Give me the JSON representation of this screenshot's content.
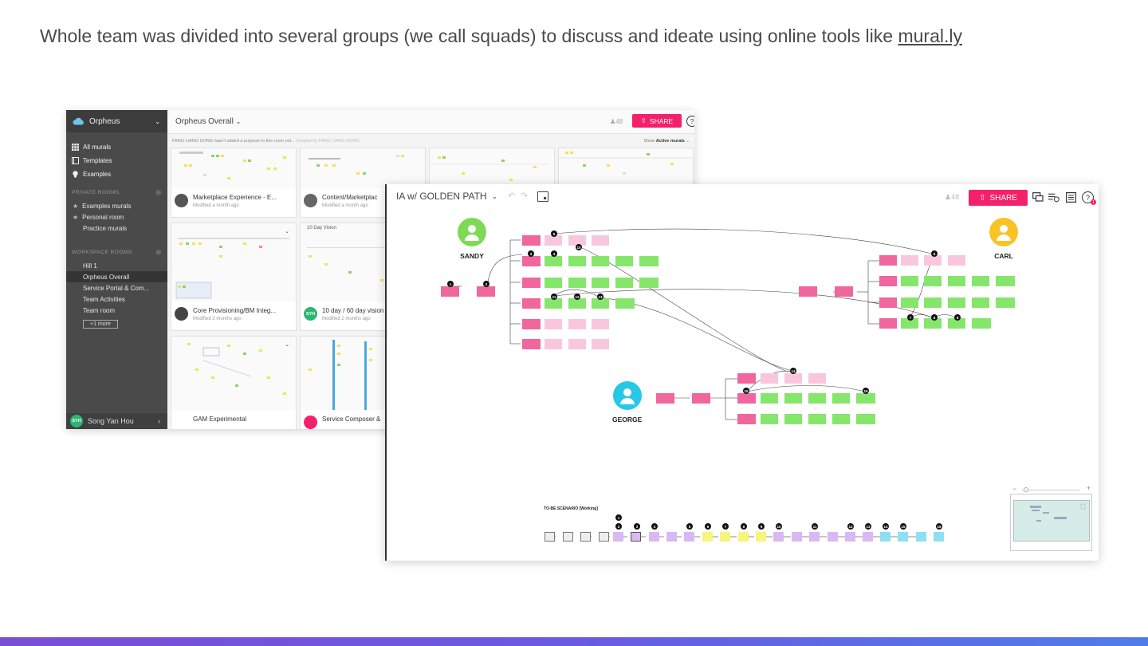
{
  "slide": {
    "heading_text": "Whole team was divided into several groups (we call squads) to discuss and ideate using online tools like ",
    "heading_link": "mural.ly"
  },
  "colors": {
    "share_pink": "#f4206a",
    "sidebar_dark": "#4a4a4a",
    "sandy_green": "#7ed957",
    "carl_yellow": "#f7c325",
    "george_cyan": "#27c7e6",
    "bottom_gradient_start": "#7a4fd6",
    "bottom_gradient_end": "#4f7ce8"
  },
  "mural_list": {
    "app_name": "Orpheus",
    "nav": [
      {
        "label": "All murals",
        "icon": "grid-icon"
      },
      {
        "label": "Templates",
        "icon": "template-icon"
      },
      {
        "label": "Examples",
        "icon": "bulb-icon"
      }
    ],
    "private_rooms_label": "PRIVATE ROOMS",
    "private_rooms": [
      {
        "label": "Examples murals",
        "starred": true
      },
      {
        "label": "Personal room",
        "starred": true
      },
      {
        "label": "Practice murals",
        "starred": false
      }
    ],
    "workspace_rooms_label": "WORKSPACE ROOMS",
    "workspace_rooms": [
      {
        "label": "Hill 1",
        "active": false
      },
      {
        "label": "Orpheus Overall",
        "active": true
      },
      {
        "label": "Service Portal & Com...",
        "active": false
      },
      {
        "label": "Team Activities",
        "active": false
      },
      {
        "label": "Team room",
        "active": false
      }
    ],
    "more_label": "+1 more",
    "user_initials": "SYH",
    "user_name": "Song Yan Hou",
    "room_title": "Orpheus Overall",
    "member_count": "48",
    "share_label": "SHARE",
    "help_label": "?",
    "purpose_text": "FANG LIANG DONG hasn't added a purpose to this room yet...",
    "created_by": "Created by FANG LIANG DONG",
    "show_prefix": "Show",
    "show_value": "Active murals",
    "cards": [
      {
        "title": "Marketplace Experience - E...",
        "subtitle": "Modified a month ago",
        "initials": ""
      },
      {
        "title": "Content/Marketplac",
        "subtitle": "Modified a month ago",
        "initials": ""
      },
      {
        "title": "Core Provisioning/BM Integ...",
        "subtitle": "Modified 2 months ago",
        "initials": ""
      },
      {
        "title": "10 day / 60 day vision",
        "subtitle": "Modified 2 months ago",
        "initials": "SYH"
      },
      {
        "title": "GAM Experimental",
        "subtitle": "",
        "initials": ""
      },
      {
        "title": "Service Composer &",
        "subtitle": "",
        "initials": ""
      }
    ],
    "card_thumb_label": "10 Day Vision"
  },
  "mural_board": {
    "title": "IA w/ GOLDEN PATH",
    "member_count": "48",
    "share_label": "SHARE",
    "help_label": "?",
    "notification_count": "1",
    "personas": [
      {
        "name": "SANDY",
        "color": "#7ed957"
      },
      {
        "name": "CARL",
        "color": "#f7c325"
      },
      {
        "name": "GEORGE",
        "color": "#27c7e6"
      }
    ],
    "scenario_title": "TO-BE SCENARIO [Working]",
    "zoom_minus": "−",
    "zoom_plus": "+"
  }
}
